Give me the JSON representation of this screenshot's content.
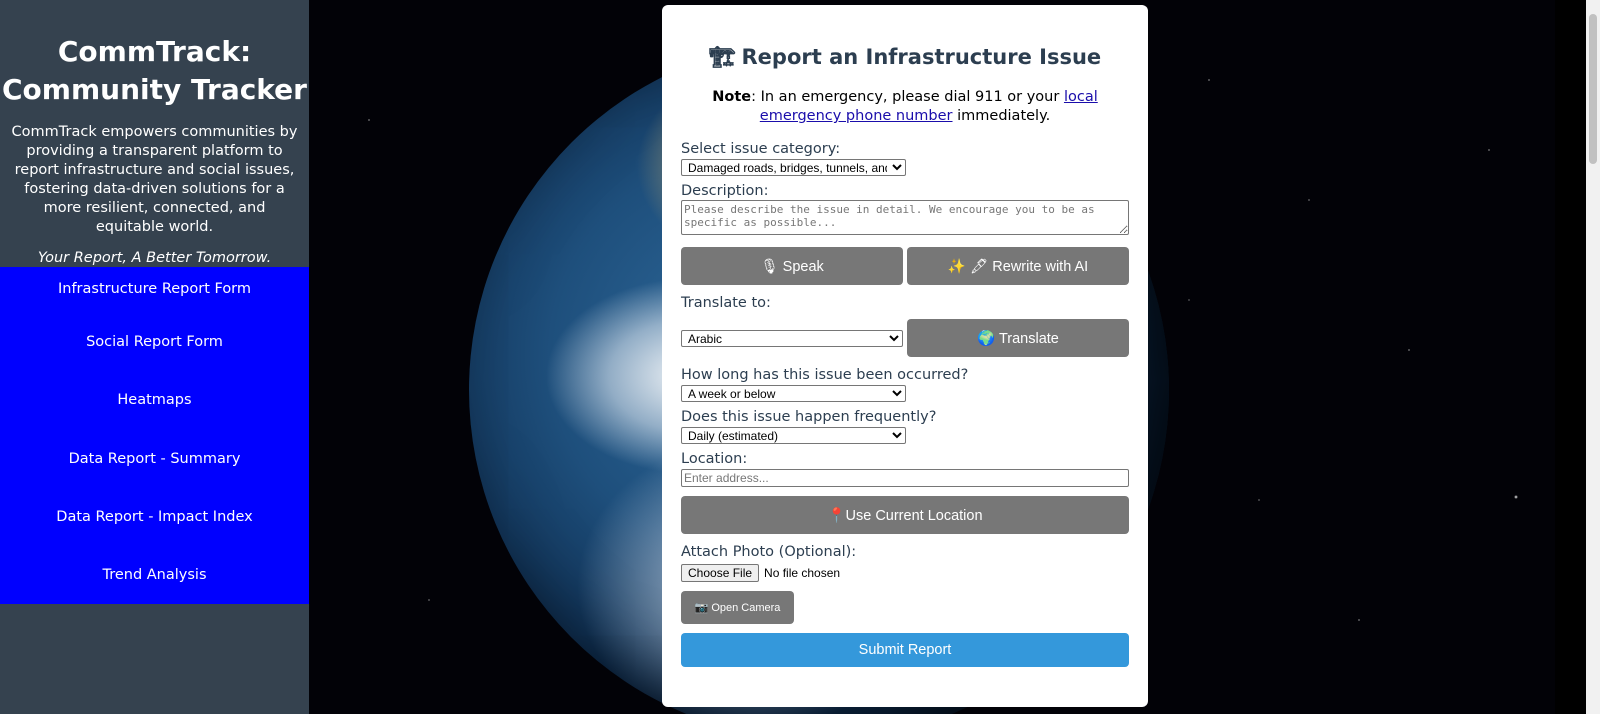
{
  "sidebar": {
    "title_line1": "CommTrack:",
    "title_line2": "Community Tracker",
    "description": "CommTrack empowers communities by providing a transparent platform to report infrastructure and social issues, fostering data-driven solutions for a more resilient, connected, and equitable world.",
    "tagline": "Your Report, A Better Tomorrow.",
    "nav": [
      {
        "label": "Infrastructure Report Form"
      },
      {
        "label": "Social Report Form"
      },
      {
        "label": "Heatmaps"
      },
      {
        "label": "Data Report - Summary"
      },
      {
        "label": "Data Report - Impact Index"
      },
      {
        "label": "Trend Analysis"
      }
    ],
    "nav_color": "#0000ff",
    "bg_color": "#35424f"
  },
  "form": {
    "title_emoji": "🏗",
    "title": "Report an Infrastructure Issue",
    "note_bold": "Note",
    "note_text": ": In an emergency, please dial 911 or your ",
    "note_link": "local emergency phone number",
    "note_end": " immediately.",
    "category_label": "Select issue category:",
    "category_value": "Damaged roads, bridges, tunnels, and",
    "description_label": "Description:",
    "description_placeholder": "Please describe the issue in detail. We encourage you to be as specific as possible...",
    "speak_button": "🎙 Speak",
    "rewrite_button": "✨ 🖋 Rewrite with AI",
    "translate_label": "Translate to:",
    "translate_value": "Arabic",
    "translate_button": "🌍 Translate",
    "duration_label": "How long has this issue been occurred?",
    "duration_value": "A week or below",
    "frequency_label": "Does this issue happen frequently?",
    "frequency_value": "Daily (estimated)",
    "location_label": "Location:",
    "location_placeholder": "Enter address...",
    "location_button": "📍Use Current Location",
    "photo_label": "Attach Photo (Optional):",
    "choose_file": "Choose File",
    "no_file": "No file chosen",
    "camera_button": "📷 Open Camera",
    "submit_button": "Submit Report",
    "accent_color": "#3498db"
  }
}
